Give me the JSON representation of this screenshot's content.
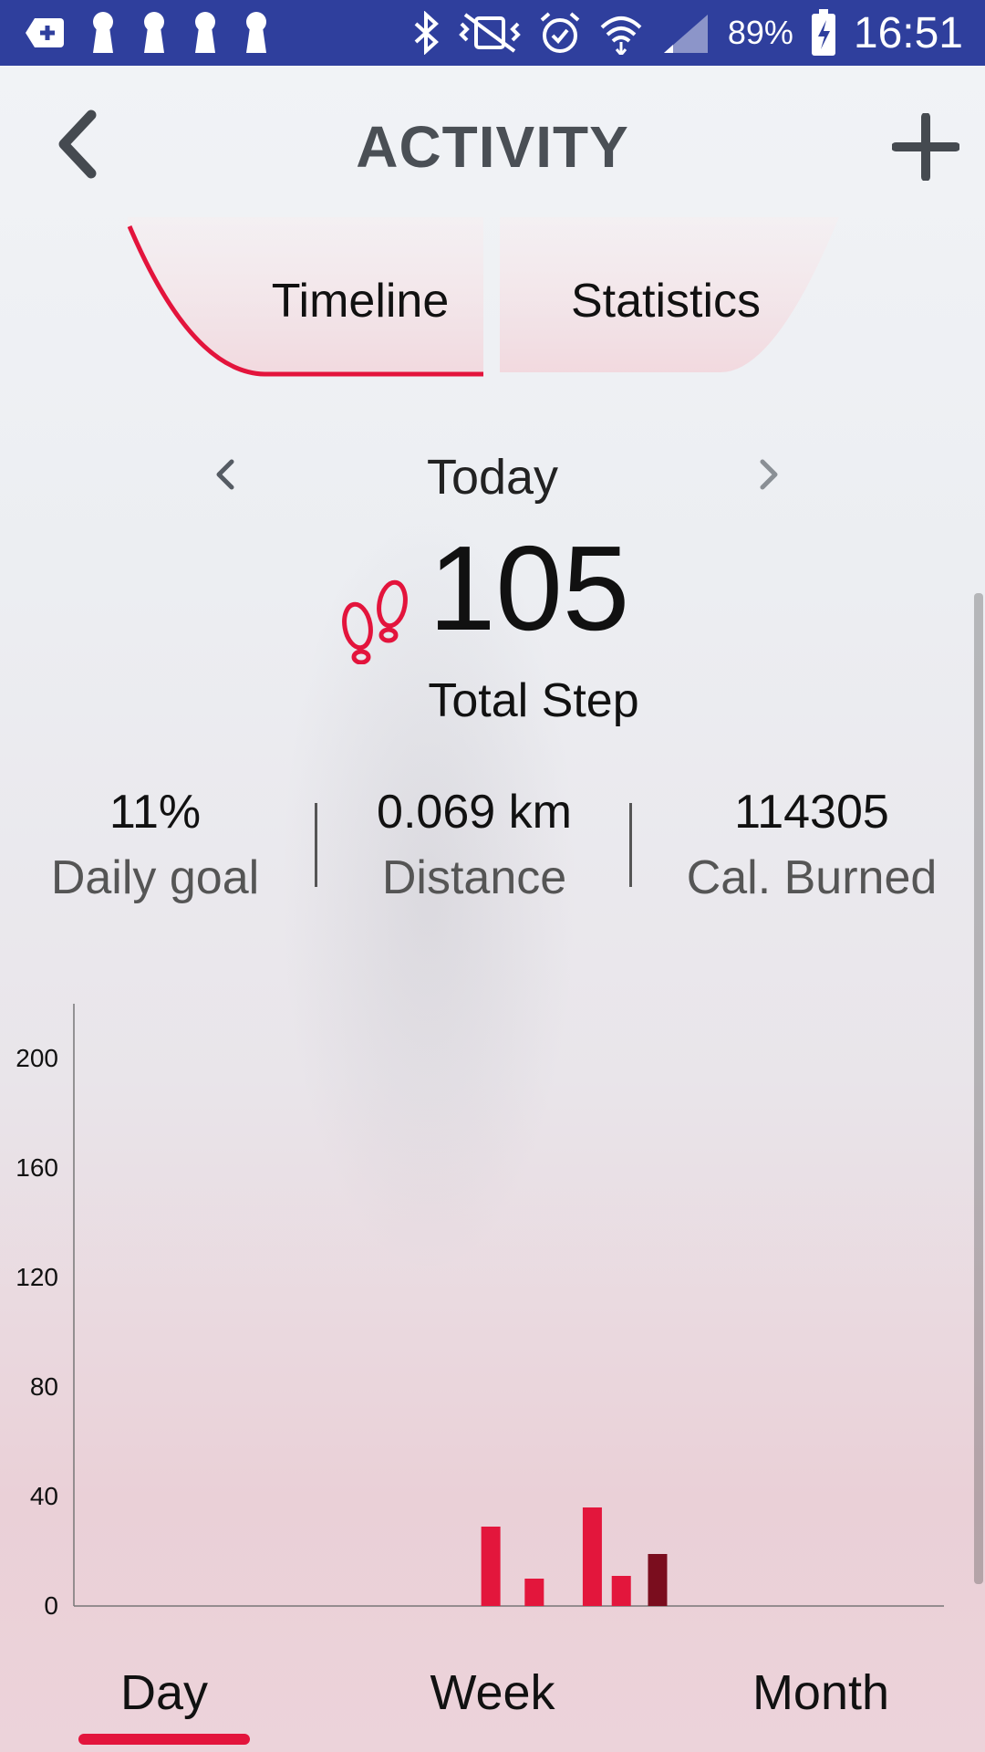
{
  "status_bar": {
    "battery": "89%",
    "time": "16:51"
  },
  "header": {
    "title": "ACTIVITY"
  },
  "tabs": [
    {
      "label": "Timeline",
      "selected": true
    },
    {
      "label": "Statistics",
      "selected": false
    }
  ],
  "date_nav": {
    "label": "Today"
  },
  "steps": {
    "value": "105",
    "label": "Total Step"
  },
  "stats": [
    {
      "value": "11%",
      "label": "Daily goal"
    },
    {
      "value": "0.069 km",
      "label": "Distance"
    },
    {
      "value": "114305",
      "label": "Cal. Burned"
    }
  ],
  "chart_data": {
    "type": "bar",
    "yticks": [
      "0",
      "40",
      "80",
      "120",
      "160",
      "200"
    ],
    "ylim": [
      0,
      220
    ],
    "bars": [
      {
        "slot": 11.5,
        "value": 29,
        "color": "#e3163c"
      },
      {
        "slot": 12.7,
        "value": 10,
        "color": "#e3163c"
      },
      {
        "slot": 14.3,
        "value": 36,
        "color": "#e3163c"
      },
      {
        "slot": 15.1,
        "value": 11,
        "color": "#e3163c"
      },
      {
        "slot": 16.1,
        "value": 19,
        "color": "#7a0d1e"
      }
    ]
  },
  "periods": [
    {
      "label": "Day",
      "selected": true
    },
    {
      "label": "Week",
      "selected": false
    },
    {
      "label": "Month",
      "selected": false
    }
  ],
  "colors": {
    "accent": "#e3143c",
    "status_bar": "#2f3f9d"
  }
}
